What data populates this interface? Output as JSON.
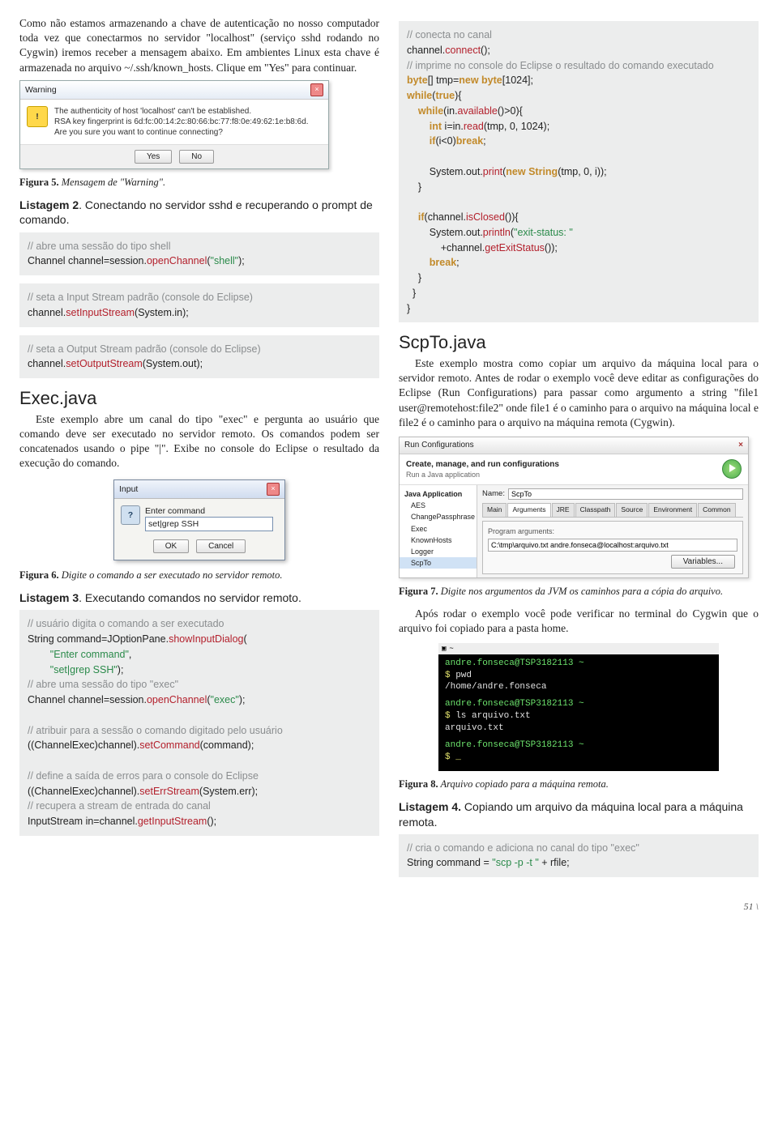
{
  "left": {
    "para1": "Como não estamos armazenando a chave de autenticação no nosso computador toda vez que conectarmos no servidor \"localhost\" (serviço sshd rodando no Cygwin) iremos receber a mensagem abaixo. Em ambientes Linux esta chave é armazenada no arquivo ~/.ssh/known_hosts. Clique em \"Yes\" para continuar.",
    "warn_dialog": {
      "title": "Warning",
      "line1": "The authenticity of host 'localhost' can't be established.",
      "line2": "RSA key fingerprint is 6d:fc:00:14:2c:80:66:bc:77:f8:0e:49:62:1e:b8:6d.",
      "line3": "Are you sure you want to continue connecting?",
      "yes": "Yes",
      "no": "No"
    },
    "fig5_b": "Figura 5.",
    "fig5_i": " Mensagem de \"Warning\".",
    "listing2_b": "Listagem 2",
    "listing2_rest": ". Conectando no servidor sshd e recuperando o prompt de comando.",
    "code2a": {
      "c1": "// abre uma sessão do tipo shell",
      "l2a": "Channel channel=session.",
      "l2m": "openChannel",
      "l2b": "(",
      "l2s": "\"shell\"",
      "l2c": ");"
    },
    "code2b": {
      "c1": "// seta a Input Stream padrão (console do Eclipse)",
      "l2a": "channel.",
      "l2m": "setInputStream",
      "l2b": "(System.in);"
    },
    "code2c": {
      "c1": "// seta a Output Stream padrão (console do Eclipse)",
      "l2a": "channel.",
      "l2m": "setOutputStream",
      "l2b": "(System.out);"
    },
    "exec_h": "Exec.java",
    "exec_p": "Este exemplo abre um canal do tipo \"exec\" e pergunta ao usuário que comando deve ser executado no servidor remoto. Os comandos podem ser concatenados usando o pipe \"|\". Exibe no console do Eclipse o resultado da execução do comando.",
    "input_dialog": {
      "title": "Input",
      "label": "Enter command",
      "value": "set|grep SSH",
      "ok": "OK",
      "cancel": "Cancel"
    },
    "fig6_b": "Figura 6.",
    "fig6_i": " Digite o comando a ser executado no servidor remoto.",
    "listing3_b": "Listagem 3",
    "listing3_rest": ". Executando comandos no servidor remoto.",
    "code3": {
      "c1": "// usuário digita o comando a ser executado",
      "l2a": "String command=JOptionPane.",
      "l2m": "showInputDialog",
      "l2b": "(",
      "l3s": "\"Enter command\"",
      "l3c": ",",
      "l4s": "\"set|grep SSH\"",
      "l4c": ");",
      "c5": "// abre uma sessão do tipo \"exec\"",
      "l6a": "Channel channel=session.",
      "l6m": "openChannel",
      "l6b": "(",
      "l6s": "\"exec\"",
      "l6c": ");",
      "c7": "// atribuir para a sessão o comando digitado pelo usuário",
      "l8a": "((ChannelExec)channel).",
      "l8m": "setCommand",
      "l8b": "(command);",
      "c9": "// define a saída de erros para o console do Eclipse",
      "l10a": "((ChannelExec)channel).",
      "l10m": "setErrStream",
      "l10b": "(System.err);",
      "c11": "// recupera a stream de entrada do canal",
      "l12a": "InputStream in=channel.",
      "l12m": "getInputStream",
      "l12b": "();"
    }
  },
  "right": {
    "code_top": {
      "c1": "// conecta no canal",
      "l2a": "channel.",
      "l2m": "connect",
      "l2b": "();",
      "c3": "// imprime no console do Eclipse o resultado do comando executado",
      "l4a": "byte",
      "l4b": "[] tmp=",
      "l4c": "new byte",
      "l4d": "[1024];",
      "l5a": "while",
      "l5b": "(",
      "l5c": "true",
      "l5d": "){",
      "l6a": "while",
      "l6b": "(in.",
      "l6m": "available",
      "l6c": "()>0){",
      "l7a": "int",
      "l7b": " i=in.",
      "l7m": "read",
      "l7c": "(tmp, 0, 1024);",
      "l8a": "if",
      "l8b": "(i<0)",
      "l8c": "break",
      "l8d": ";",
      "l9a": "System.out.",
      "l9m": "print",
      "l9b": "(",
      "l9c": "new String",
      "l9d": "(tmp, 0, i));",
      "l10": "}",
      "l11a": "if",
      "l11b": "(channel.",
      "l11m": "isClosed",
      "l11c": "()){",
      "l12a": "System.out.",
      "l12m": "println",
      "l12b": "(",
      "l12s": "\"exit-status: \"",
      "l13a": "+channel.",
      "l13m": "getExitStatus",
      "l13b": "());",
      "l14a": "break",
      "l14b": ";",
      "l15": "}",
      "l16": "}",
      "l17": "}"
    },
    "scpto_h": "ScpTo.java",
    "scpto_p": "Este exemplo mostra como copiar um arquivo da máquina local para o servidor remoto. Antes de rodar o exemplo você deve editar as configurações do Eclipse (Run Configurations) para passar como argumento a string \"file1 user@remotehost:file2\" onde file1 é o caminho para o arquivo na máquina local e file2 é o caminho para o arquivo na máquina remota (Cygwin).",
    "runconfig": {
      "win_title": "Run Configurations",
      "header": "Create, manage, and run configurations",
      "sub": "Run a Java application",
      "sidebar": [
        "Java Application",
        "AES",
        "ChangePassphrase",
        "Exec",
        "KnownHosts",
        "Logger",
        "ScpTo"
      ],
      "name_label": "Name:",
      "name_value": "ScpTo",
      "tabs": [
        "Main",
        "Arguments",
        "JRE",
        "Classpath",
        "Source",
        "Environment",
        "Common"
      ],
      "group_title": "Program arguments:",
      "arg_value": "C:\\tmp\\arquivo.txt andre.fonseca@localhost:arquivo.txt",
      "variables": "Variables..."
    },
    "fig7_b": "Figura 7.",
    "fig7_i": " Digite nos argumentos da JVM os caminhos para a cópia do arquivo.",
    "after_p": "Após rodar o exemplo você pode verificar no terminal do Cygwin que o arquivo foi copiado para a pasta home.",
    "terminal": {
      "l1": "andre.fonseca@TSP3182113 ~",
      "l2p": "$ ",
      "l2c": "pwd",
      "l3": "/home/andre.fonseca",
      "l4": "andre.fonseca@TSP3182113 ~",
      "l5p": "$ ",
      "l5c": "ls arquivo.txt",
      "l6": "arquivo.txt",
      "l7": "andre.fonseca@TSP3182113 ~",
      "l8": "$ _"
    },
    "fig8_b": "Figura 8.",
    "fig8_i": " Arquivo copiado para a máquina remota.",
    "listing4_b": "Listagem 4.",
    "listing4_rest": " Copiando um arquivo da máquina local para a máquina remota.",
    "code4": {
      "c1": "// cria o comando e adiciona no canal do tipo \"exec\"",
      "l2a": "String command = ",
      "l2s": "\"scp -p -t \"",
      "l2b": " + rfile;"
    }
  },
  "footer": "51 \\"
}
